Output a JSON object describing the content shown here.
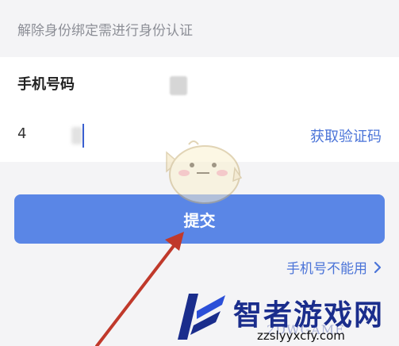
{
  "notice": {
    "text": "解除身份绑定需进行身份认证"
  },
  "form": {
    "phone_label": "手机号码",
    "code_value": "4",
    "get_code_label": "获取验证码"
  },
  "submit": {
    "label": "提交"
  },
  "alt_link": {
    "label": "手机号不能用"
  },
  "watermark": {
    "title": "智者游戏网",
    "url": "zzslyyxcfy.com",
    "english": "2DWGAME"
  },
  "colors": {
    "accent_blue": "#5a86e6",
    "link_blue": "#4b74d8",
    "arrow_red": "#c0392b",
    "watermark_navy": "#1a2d8c"
  },
  "icons": [
    "chevron-right-icon",
    "mascot-sticker",
    "red-arrow-annotation",
    "watermark-logo"
  ]
}
